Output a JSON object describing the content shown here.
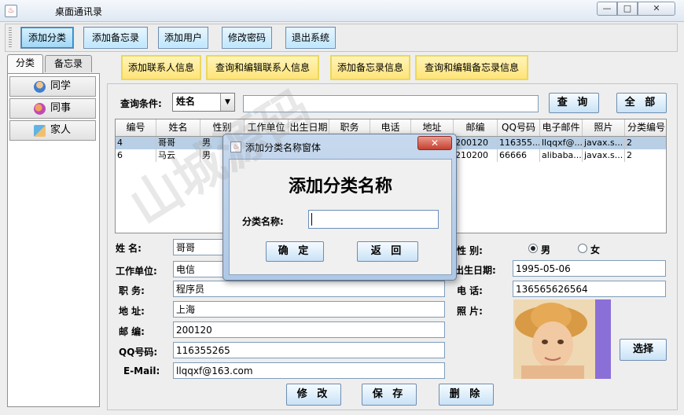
{
  "window": {
    "title": "桌面通讯录",
    "min_glyph": "—",
    "max_glyph": "□",
    "close_glyph": "✕"
  },
  "toolbar": {
    "buttons": [
      "添加分类",
      "添加备忘录",
      "添加用户",
      "修改密码",
      "退出系统"
    ]
  },
  "left_tabs": [
    "分类",
    "备忘录"
  ],
  "categories": [
    {
      "label": "同学",
      "icon": "classmate-icon"
    },
    {
      "label": "同事",
      "icon": "colleague-icon"
    },
    {
      "label": "家人",
      "icon": "family-icon"
    }
  ],
  "right_tabs": [
    "添加联系人信息",
    "查询和编辑联系人信息",
    "添加备忘录信息",
    "查询和编辑备忘录信息"
  ],
  "query": {
    "label": "查询条件:",
    "field_value": "姓名",
    "search_value": "",
    "search_button": "查 询",
    "all_button": "全 部"
  },
  "table": {
    "columns": [
      "编号",
      "姓名",
      "性别",
      "工作单位",
      "出生日期",
      "职务",
      "电话",
      "地址",
      "邮编",
      "QQ号码",
      "电子邮件",
      "照片",
      "分类编号"
    ],
    "rows": [
      [
        "4",
        "哥哥",
        "男",
        "",
        "",
        "",
        "",
        "",
        "200120",
        "116355...",
        "llqqxf@...",
        "javax.s...",
        "2"
      ],
      [
        "6",
        "马云",
        "男",
        "",
        "",
        "",
        "",
        "",
        "210200",
        "66666",
        "alibaba...",
        "javax.s...",
        "2"
      ]
    ]
  },
  "form": {
    "name_label": "姓    名:",
    "name_value": "哥哥",
    "work_label": "工作单位:",
    "work_value": "电信",
    "job_label": "职    务:",
    "job_value": "程序员",
    "address_label": "地    址:",
    "address_value": "上海",
    "zip_label": "邮    编:",
    "zip_value": "200120",
    "qq_label": "QQ号码:",
    "qq_value": "116355265",
    "email_label": "E-Mail:",
    "email_value": "llqqxf@163.com",
    "gender_label": "性    别:",
    "gender_male": "男",
    "gender_female": "女",
    "birth_label": "出生日期:",
    "birth_value": "1995-05-06",
    "phone_label": "电    话:",
    "phone_value": "136565626564",
    "photo_label": "照    片:",
    "choose_button": "选择",
    "edit_button": "修 改",
    "save_button": "保 存",
    "delete_button": "删 除"
  },
  "dialog": {
    "title": "添加分类名称窗体",
    "heading": "添加分类名称",
    "field_label": "分类名称:",
    "field_value": "",
    "ok_button": "确 定",
    "back_button": "返 回",
    "close_glyph": "✕"
  },
  "watermark": {
    "text": "山城源码"
  },
  "colors": {
    "accent": "#bde6fd",
    "tab_yellow": "#ffe47a",
    "selected_row": "#b8cfe5",
    "photo_purple": "#8b6fd8"
  }
}
